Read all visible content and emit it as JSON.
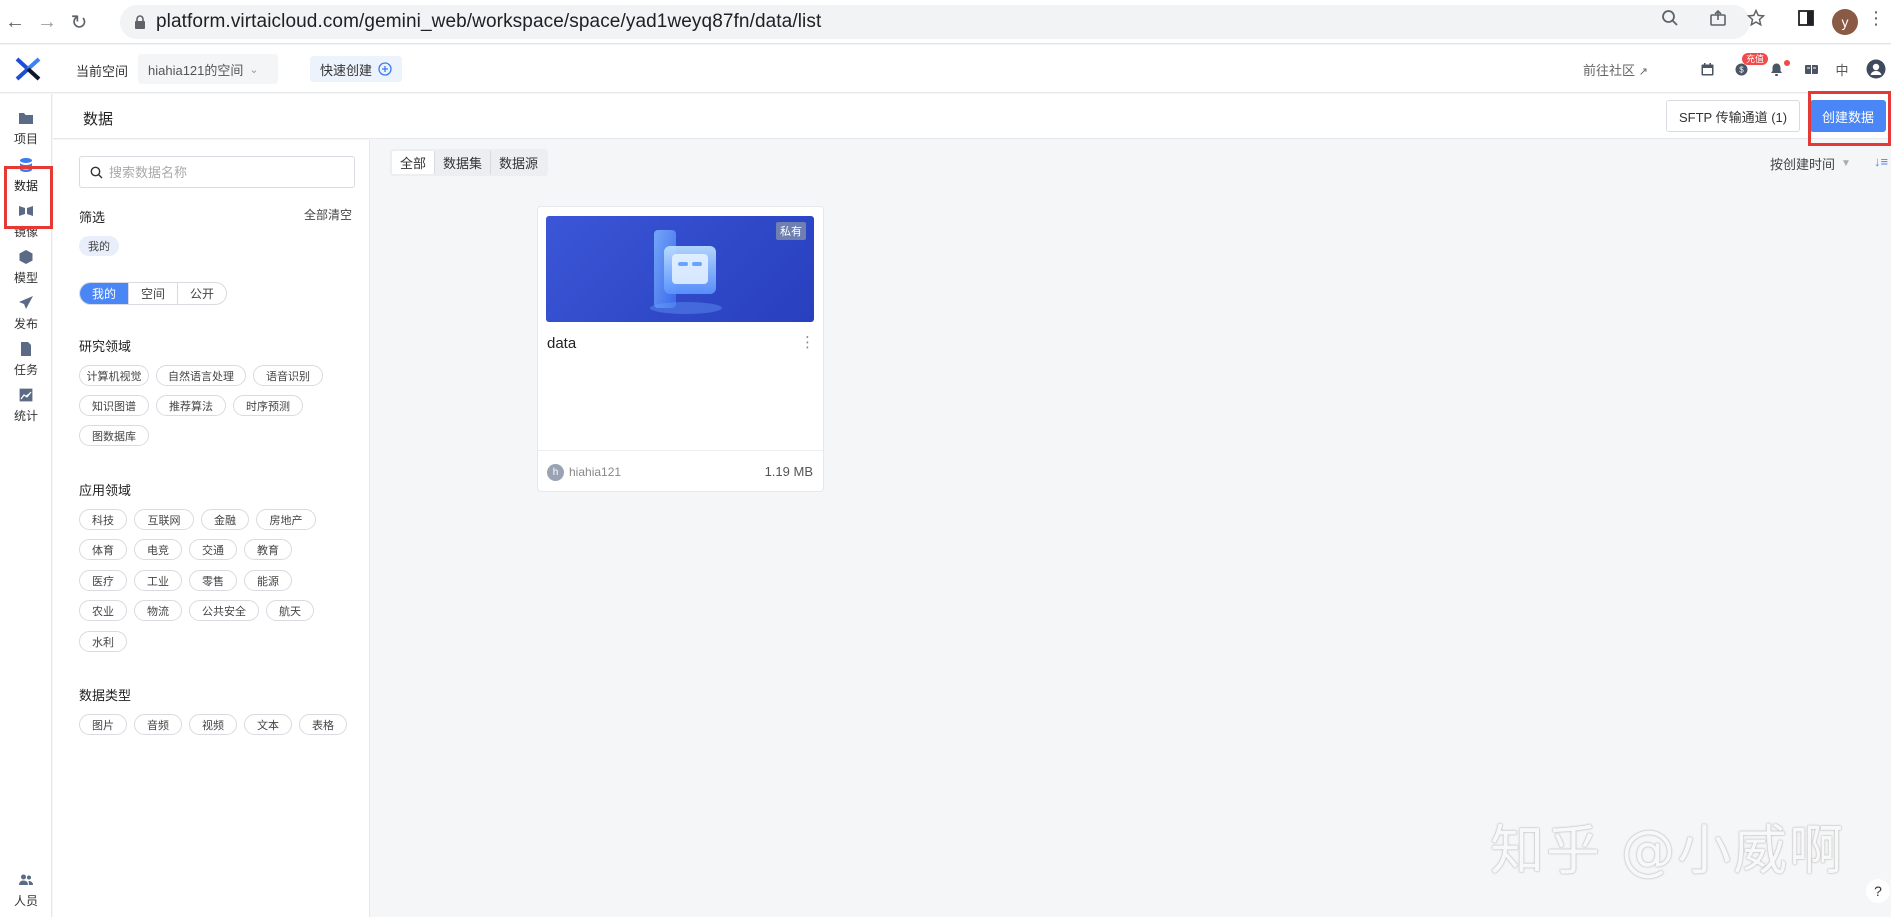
{
  "browser": {
    "url": "platform.virtaicloud.com/gemini_web/workspace/space/yad1weyq87fn/data/list",
    "profile_initial": "y"
  },
  "header": {
    "current_space_label": "当前空间",
    "space_name": "hiahia121的空间",
    "quick_create": "快速创建",
    "community": "前往社区",
    "charge_badge": "充值",
    "language": "中"
  },
  "rail": {
    "items": [
      {
        "label": "项目"
      },
      {
        "label": "数据"
      },
      {
        "label": "镜像"
      },
      {
        "label": "模型"
      },
      {
        "label": "发布"
      },
      {
        "label": "任务"
      },
      {
        "label": "统计"
      }
    ],
    "bottom": {
      "label": "人员"
    }
  },
  "page": {
    "title": "数据",
    "sftp_button": "SFTP 传输通道 (1)",
    "create_button": "创建数据"
  },
  "filter": {
    "search_placeholder": "搜索数据名称",
    "title": "筛选",
    "clear_all": "全部清空",
    "selected_chip": "我的",
    "scope_tabs": [
      "我的",
      "空间",
      "公开"
    ],
    "research_title": "研究领域",
    "research_tags": [
      "计算机视觉",
      "自然语言处理",
      "语音识别",
      "知识图谱",
      "推荐算法",
      "时序预测",
      "图数据库"
    ],
    "application_title": "应用领域",
    "application_tags": [
      "科技",
      "互联网",
      "金融",
      "房地产",
      "体育",
      "电竞",
      "交通",
      "教育",
      "医疗",
      "工业",
      "零售",
      "能源",
      "农业",
      "物流",
      "公共安全",
      "航天",
      "水利"
    ],
    "type_title": "数据类型",
    "type_tags": [
      "图片",
      "音频",
      "视频",
      "文本",
      "表格"
    ]
  },
  "content": {
    "tabs": [
      "全部",
      "数据集",
      "数据源"
    ],
    "sort_label": "按创建时间",
    "card": {
      "badge": "私有",
      "name": "data",
      "owner_initial": "h",
      "owner": "hiahia121",
      "size": "1.19 MB"
    }
  },
  "watermark": "知乎 @小威啊",
  "help": "?",
  "colors": {
    "accent": "#4a86f5",
    "highlight": "#e53935"
  }
}
